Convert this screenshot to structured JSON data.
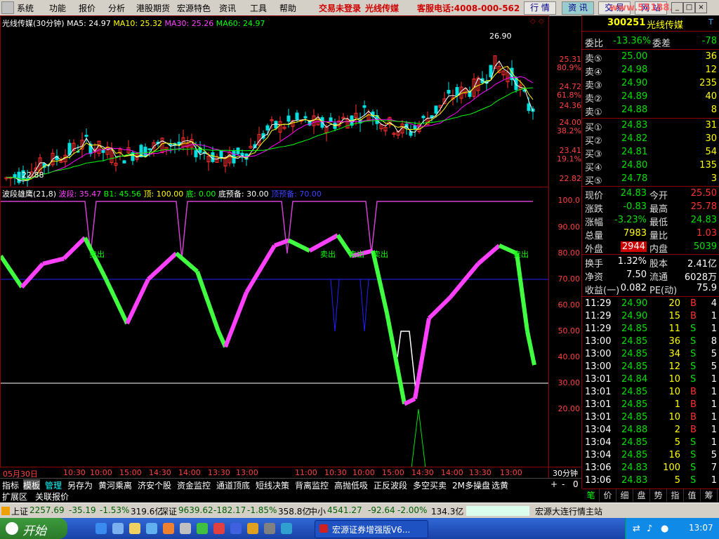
{
  "menu": {
    "items": [
      "系统",
      "功能",
      "报价",
      "分析",
      "港股期货",
      "宏源特色",
      "资讯",
      "工具",
      "帮助"
    ],
    "notice1": "交易未登录",
    "notice2": "光线传媒",
    "phone": "客服电话:4008-000-562",
    "right_buttons": [
      "行 情",
      "资 讯",
      "交 易",
      "网 站"
    ],
    "watermark": "www.55188.com"
  },
  "main_chart": {
    "title": "光线传媒(30分钟)",
    "ma5": "MA5: 24.97",
    "ma10": "MA10: 25.32",
    "ma30": "MA30: 25.26",
    "ma60": "MA60: 24.97",
    "high_label": "26.90",
    "low_label": "22.88",
    "y_labels": [
      "25.31",
      "80.9%",
      "24.72",
      "61.8%",
      "24.36",
      "24.00",
      "38.2%",
      "23.41",
      "19.1%",
      "22.82"
    ],
    "colors": {
      "ma5": "#ffffff",
      "ma10": "#ffff00",
      "ma30": "#ff00ff",
      "ma60": "#00ff00"
    }
  },
  "indicator": {
    "title": "波段雄鹰(21,8)",
    "wave": "波段: 35.47",
    "b1": "B1: 45.56",
    "top": "顶: 100.00",
    "bottom": "底: 0.00",
    "bottom_warn": "底预备: 30.00",
    "top_warn": "顶预备: 70.00",
    "sell_label": "卖出",
    "y_labels": [
      "100.0",
      "90.00",
      "80.00",
      "70.00",
      "60.00",
      "50.00",
      "40.00",
      "30.00",
      "20.00"
    ]
  },
  "time_axis": {
    "labels": [
      "05月30日",
      "10:30",
      "10:00",
      "15:00",
      "14:30",
      "14:00",
      "13:30",
      "13:00",
      "11:00",
      "10:30",
      "10:00",
      "15:00",
      "14:30",
      "14:00",
      "13:30",
      "13:00"
    ],
    "period": "30分钟",
    "zoom": [
      "+",
      "-",
      "0"
    ]
  },
  "tabs": [
    "指标",
    "模板",
    "管理",
    "另存为",
    "黄河乘离",
    "济安个股",
    "资金监控",
    "通道顶底",
    "短线决策",
    "背离监控",
    "高抛低吸",
    "正反波段",
    "多空买卖",
    "2M多操盘",
    "选黄"
  ],
  "tabs_row2": [
    "扩展区",
    "关联报价"
  ],
  "quote": {
    "code": "300251",
    "name": "光线传媒",
    "ratio_label": "委比",
    "ratio": "-13.36%",
    "diff_label": "委差",
    "diff": "-78",
    "sells": [
      {
        "label": "卖⑤",
        "price": "25.00",
        "vol": "36"
      },
      {
        "label": "卖④",
        "price": "24.98",
        "vol": "12"
      },
      {
        "label": "卖③",
        "price": "24.90",
        "vol": "235"
      },
      {
        "label": "卖②",
        "price": "24.89",
        "vol": "40"
      },
      {
        "label": "卖①",
        "price": "24.88",
        "vol": "8"
      }
    ],
    "buys": [
      {
        "label": "买①",
        "price": "24.83",
        "vol": "31"
      },
      {
        "label": "买②",
        "price": "24.82",
        "vol": "30"
      },
      {
        "label": "买③",
        "price": "24.81",
        "vol": "54"
      },
      {
        "label": "买④",
        "price": "24.80",
        "vol": "135"
      },
      {
        "label": "买⑤",
        "price": "24.78",
        "vol": "3"
      }
    ],
    "stats": [
      {
        "l1": "现价",
        "v1": "24.83",
        "l2": "今开",
        "v2": "25.50"
      },
      {
        "l1": "涨跌",
        "v1": "-0.83",
        "l2": "最高",
        "v2": "25.78"
      },
      {
        "l1": "涨幅",
        "v1": "-3.23%",
        "l2": "最低",
        "v2": "24.83"
      },
      {
        "l1": "总量",
        "v1": "7983",
        "l2": "量比",
        "v2": "1.03"
      },
      {
        "l1": "外盘",
        "v1": "2944",
        "l2": "内盘",
        "v2": "5039"
      }
    ],
    "stats2": [
      {
        "l1": "换手",
        "v1": "1.32%",
        "l2": "股本",
        "v2": "2.41亿"
      },
      {
        "l1": "净资",
        "v1": "7.50",
        "l2": "流通",
        "v2": "6028万"
      },
      {
        "l1": "收益(一)",
        "v1": "0.082",
        "l2": "PE(动)",
        "v2": "75.9"
      }
    ],
    "ticks": [
      {
        "t": "11:29",
        "p": "24.90",
        "v": "20",
        "s": "B",
        "n": "4"
      },
      {
        "t": "11:29",
        "p": "24.90",
        "v": "15",
        "s": "B",
        "n": "1"
      },
      {
        "t": "11:29",
        "p": "24.85",
        "v": "11",
        "s": "S",
        "n": "1"
      },
      {
        "t": "13:00",
        "p": "24.85",
        "v": "36",
        "s": "S",
        "n": "8"
      },
      {
        "t": "13:00",
        "p": "24.85",
        "v": "34",
        "s": "S",
        "n": "5"
      },
      {
        "t": "13:00",
        "p": "24.85",
        "v": "12",
        "s": "S",
        "n": "5"
      },
      {
        "t": "13:01",
        "p": "24.84",
        "v": "10",
        "s": "S",
        "n": "1"
      },
      {
        "t": "13:01",
        "p": "24.85",
        "v": "10",
        "s": "B",
        "n": "1"
      },
      {
        "t": "13:01",
        "p": "24.85",
        "v": "1",
        "s": "B",
        "n": "1"
      },
      {
        "t": "13:01",
        "p": "24.85",
        "v": "10",
        "s": "B",
        "n": "1"
      },
      {
        "t": "13:04",
        "p": "24.88",
        "v": "2",
        "s": "B",
        "n": "1"
      },
      {
        "t": "13:04",
        "p": "24.85",
        "v": "5",
        "s": "S",
        "n": "1"
      },
      {
        "t": "13:04",
        "p": "24.85",
        "v": "16",
        "s": "S",
        "n": "5"
      },
      {
        "t": "13:06",
        "p": "24.83",
        "v": "100",
        "s": "S",
        "n": "7"
      },
      {
        "t": "13:06",
        "p": "24.83",
        "v": "5",
        "s": "S",
        "n": "1"
      }
    ],
    "bottom_tabs": [
      "笔",
      "价",
      "细",
      "盘",
      "势",
      "指",
      "值",
      "筹"
    ]
  },
  "status": {
    "sh_label": "上证",
    "sh_val": "2257.69",
    "sh_chg": "-35.19",
    "sh_pct": "-1.53%",
    "sh_amt": "319.6亿",
    "sz_label": "深证",
    "sz_val": "9639.62",
    "sz_chg": "-182.17",
    "sz_pct": "-1.85%",
    "sz_amt": "358.8亿",
    "zx_label": "中小",
    "zx_val": "4541.27",
    "zx_chg": "-92.64",
    "zx_pct": "-2.00%",
    "zx_amt": "134.3亿",
    "broker": "宏源大连行情主站"
  },
  "taskbar": {
    "start": "开始",
    "task": "宏源证券增强版V6...",
    "clock": "13:07"
  }
}
